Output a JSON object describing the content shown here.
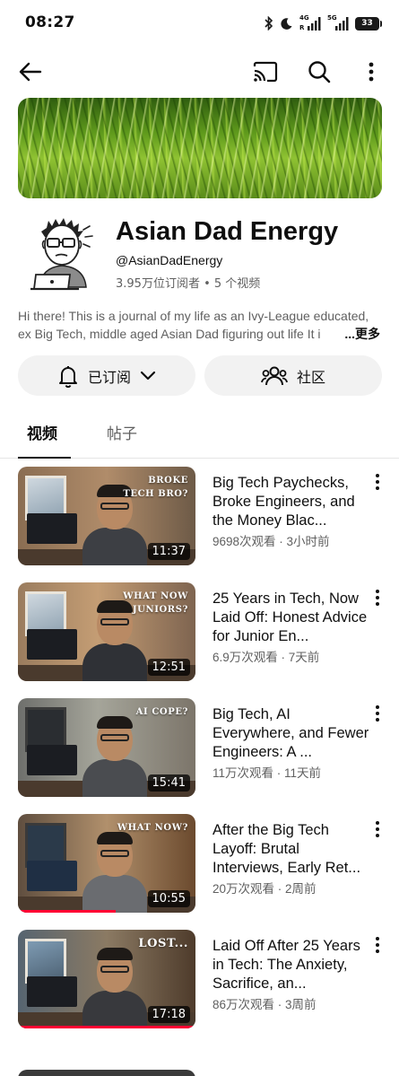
{
  "status_bar": {
    "time": "08:27",
    "battery": "33",
    "net1": "4G",
    "net2": "5G"
  },
  "channel": {
    "name": "Asian Dad Energy",
    "handle": "@AsianDadEnergy",
    "stats": "3.95万位订阅者 • 5 个视频",
    "description_line1": "Hi there!  This is a journal of my life as an Ivy-League educated,",
    "description_line2": "ex Big Tech, middle aged Asian Dad figuring out life  It i",
    "more_label": "...更多"
  },
  "buttons": {
    "subscribed_label": "已订阅",
    "community_label": "社区"
  },
  "tabs": [
    {
      "label": "视频"
    },
    {
      "label": "帖子"
    }
  ],
  "videos": [
    {
      "title": "Big Tech Paychecks, Broke Engineers, and the Money Blac...",
      "meta": "9698次观看 · 3小时前",
      "duration": "11:37",
      "caption_l1": "BROKE",
      "caption_l2": "TECH BRO?",
      "progress": 0
    },
    {
      "title": "25 Years in Tech, Now Laid Off: Honest Advice for Junior En...",
      "meta": "6.9万次观看 · 7天前",
      "duration": "12:51",
      "caption_l1": "WHAT NOW",
      "caption_l2": "JUNIORS?",
      "progress": 0
    },
    {
      "title": "Big Tech, AI Everywhere, and Fewer Engineers: A ...",
      "meta": "11万次观看 · 11天前",
      "duration": "15:41",
      "caption_l1": "AI COPE?",
      "caption_l2": "",
      "progress": 0
    },
    {
      "title": "After the Big Tech Layoff: Brutal Interviews, Early Ret...",
      "meta": "20万次观看 · 2周前",
      "duration": "10:55",
      "caption_l1": "WHAT NOW?",
      "caption_l2": "",
      "progress": 0.55
    },
    {
      "title": "Laid Off After 25 Years in Tech: The Anxiety, Sacrifice, an...",
      "meta": "86万次观看 · 3周前",
      "duration": "17:18",
      "caption_l1": "LOST...",
      "caption_l2": "",
      "progress": 1.0
    }
  ],
  "icons": {
    "back": "back-arrow-icon",
    "cast": "cast-icon",
    "search": "search-icon",
    "more": "more-vertical-icon",
    "bell": "bell-icon",
    "chevron": "chevron-down-icon",
    "people": "people-icon"
  },
  "colors": {
    "progress": "#ff0033",
    "pill_bg": "#f2f2f2",
    "secondary_text": "#606060"
  }
}
